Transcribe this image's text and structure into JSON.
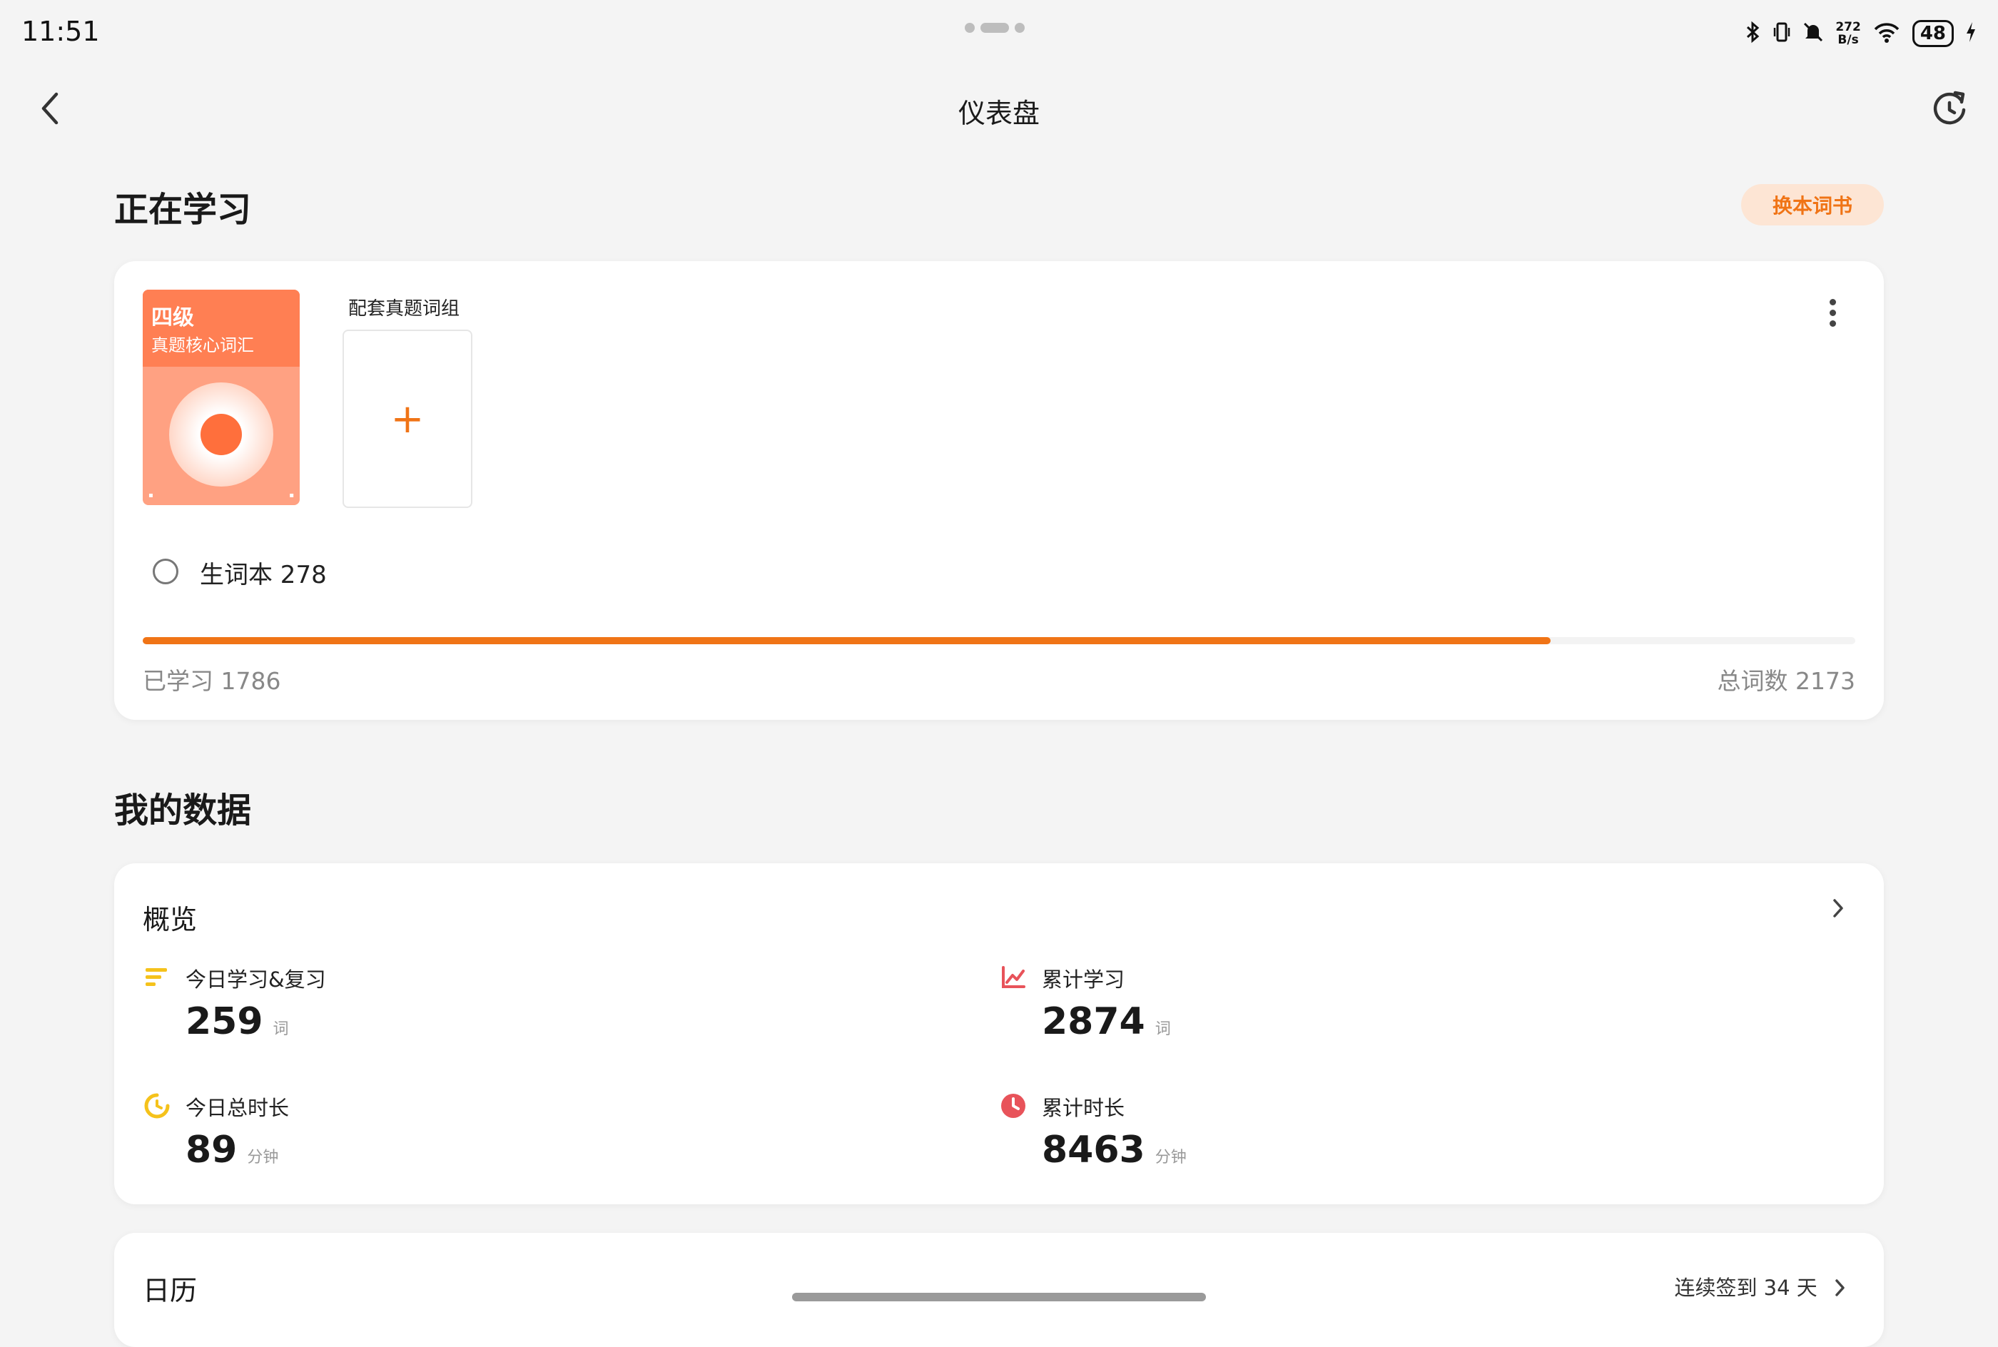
{
  "status_bar": {
    "time": "11:51",
    "net_speed_value": "272",
    "net_speed_unit": "B/s",
    "battery": "48",
    "icons": [
      "bluetooth-icon",
      "vibrate-icon",
      "mute-icon",
      "wifi-icon",
      "battery-icon",
      "charging-icon"
    ]
  },
  "nav": {
    "title": "仪表盘",
    "back_icon": "chevron-left-icon",
    "refresh_icon": "refresh-icon"
  },
  "studying": {
    "title": "正在学习",
    "switch_button": "换本词书",
    "book": {
      "level": "四级",
      "subtitle": "真题核心词汇"
    },
    "pair_label": "配套真题词组",
    "add_symbol": "+",
    "vocab_book": "生词本 278",
    "learned": "已学习 1786",
    "total": "总词数 2173",
    "progress_fraction": 0.8219,
    "accent_color": "#f07416"
  },
  "my_data": {
    "title": "我的数据",
    "overview": {
      "title": "概览",
      "stats": [
        {
          "label": "今日学习&复习",
          "value": "259",
          "unit": "词",
          "icon": "list-icon",
          "color": "#f5c21b"
        },
        {
          "label": "累计学习",
          "value": "2874",
          "unit": "词",
          "icon": "line-chart-icon",
          "color": "#e8535a"
        },
        {
          "label": "今日总时长",
          "value": "89",
          "unit": "分钟",
          "icon": "progress-ring-icon",
          "color": "#f5c21b"
        },
        {
          "label": "累计时长",
          "value": "8463",
          "unit": "分钟",
          "icon": "clock-icon",
          "color": "#e8535a"
        }
      ]
    },
    "calendar": {
      "title": "日历",
      "streak": "连续签到 34 天"
    }
  }
}
